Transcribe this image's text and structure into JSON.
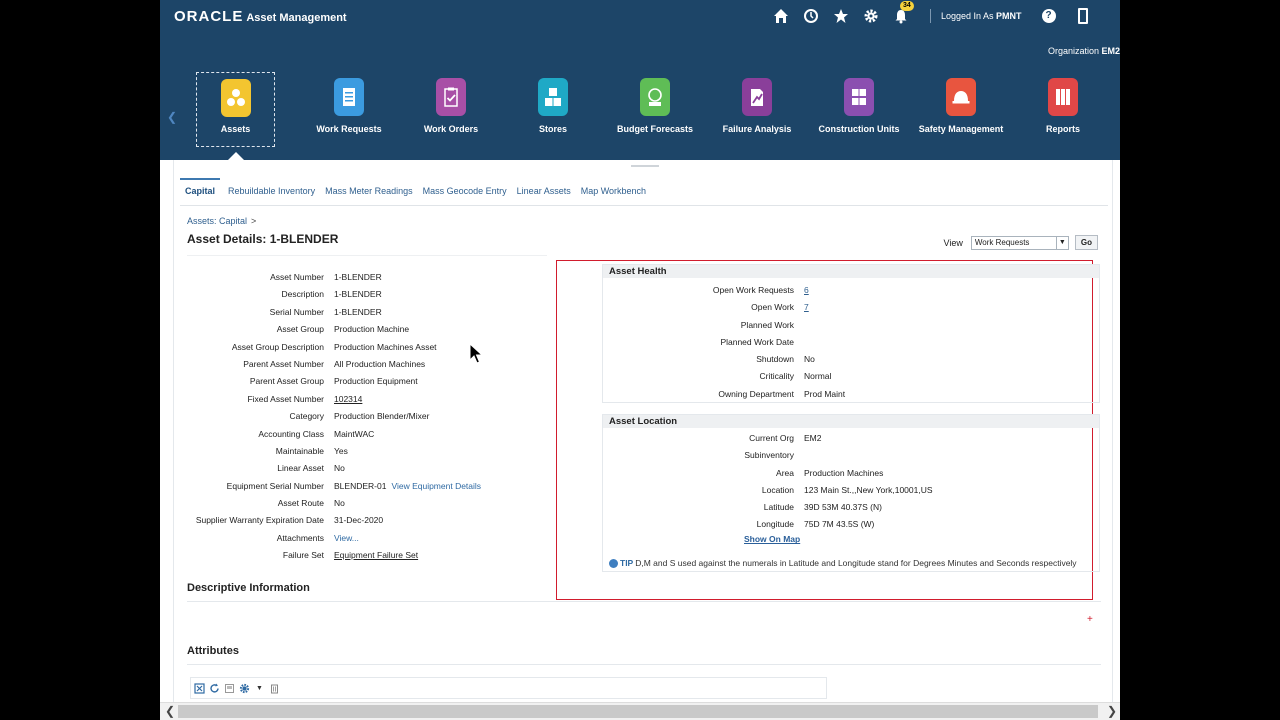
{
  "brand": {
    "oracle": "ORACLE",
    "app": "Asset Management"
  },
  "topbar": {
    "notification_count": "34",
    "logged_in_prefix": "Logged In As ",
    "user": "PMNT",
    "help": "?"
  },
  "org": {
    "label": "Organization ",
    "value": "EM2"
  },
  "nav": [
    {
      "label": "Assets",
      "color": "#f3c530"
    },
    {
      "label": "Work Requests",
      "color": "#3b9be0"
    },
    {
      "label": "Work Orders",
      "color": "#a84fa6"
    },
    {
      "label": "Stores",
      "color": "#1fa9c6"
    },
    {
      "label": "Budget Forecasts",
      "color": "#5fbd56"
    },
    {
      "label": "Failure Analysis",
      "color": "#8a3f9a"
    },
    {
      "label": "Construction Units",
      "color": "#8b4fb0"
    },
    {
      "label": "Safety Management",
      "color": "#e8553f"
    },
    {
      "label": "Reports",
      "color": "#e04747"
    }
  ],
  "tabs": [
    "Capital",
    "Rebuildable Inventory",
    "Mass Meter Readings",
    "Mass Geocode Entry",
    "Linear Assets",
    "Map Workbench"
  ],
  "breadcrumb": {
    "link": "Assets: Capital",
    "sep": ">"
  },
  "page_title": "Asset Details: 1-BLENDER",
  "view": {
    "label": "View",
    "selected": "Work Requests",
    "go": "Go"
  },
  "details": [
    {
      "label": "Asset Number",
      "value": "1-BLENDER"
    },
    {
      "label": "Description",
      "value": "1-BLENDER"
    },
    {
      "label": "Serial Number",
      "value": "1-BLENDER"
    },
    {
      "label": "Asset Group",
      "value": "Production Machine"
    },
    {
      "label": "Asset Group Description",
      "value": "Production Machines Asset"
    },
    {
      "label": "Parent Asset Number",
      "value": "All Production Machines"
    },
    {
      "label": "Parent Asset Group",
      "value": "Production Equipment"
    },
    {
      "label": "Fixed Asset Number",
      "value": "102314"
    },
    {
      "label": "Category",
      "value": "Production Blender/Mixer"
    },
    {
      "label": "Accounting Class",
      "value": "MaintWAC"
    },
    {
      "label": "Maintainable",
      "value": "Yes"
    },
    {
      "label": "Linear Asset",
      "value": "No"
    },
    {
      "label": "Equipment Serial Number",
      "value": "BLENDER-01",
      "link": "View Equipment Details"
    },
    {
      "label": "Asset Route",
      "value": "No"
    },
    {
      "label": "Supplier Warranty Expiration Date",
      "value": "31-Dec-2020"
    },
    {
      "label": "Attachments",
      "value": "View..."
    },
    {
      "label": "Failure Set",
      "value": "Equipment Failure Set"
    }
  ],
  "health": {
    "title": "Asset Health",
    "rows": [
      {
        "label": "Open Work Requests",
        "value": "6"
      },
      {
        "label": "Open Work",
        "value": "7"
      },
      {
        "label": "Planned Work",
        "value": ""
      },
      {
        "label": "Planned Work Date",
        "value": ""
      },
      {
        "label": "Shutdown",
        "value": "No"
      },
      {
        "label": "Criticality",
        "value": "Normal"
      },
      {
        "label": "Owning Department",
        "value": "Prod Maint"
      }
    ]
  },
  "location": {
    "title": "Asset Location",
    "rows": [
      {
        "label": "Current Org",
        "value": "EM2"
      },
      {
        "label": "Subinventory",
        "value": ""
      },
      {
        "label": "Area",
        "value": "Production Machines"
      },
      {
        "label": "Location",
        "value": "123 Main St.,,New York,10001,US"
      },
      {
        "label": "Latitude",
        "value": "39D 53M 40.37S (N)"
      },
      {
        "label": "Longitude",
        "value": "75D 7M 43.5S (W)"
      }
    ],
    "show_on_map": "Show On Map",
    "tip_label": "TIP",
    "tip_text": "D,M and S used against the numerals in Latitude and Longitude stand for Degrees Minutes and Seconds respectively"
  },
  "sections": {
    "descriptive": "Descriptive Information",
    "attributes": "Attributes"
  },
  "required_marker": "+"
}
